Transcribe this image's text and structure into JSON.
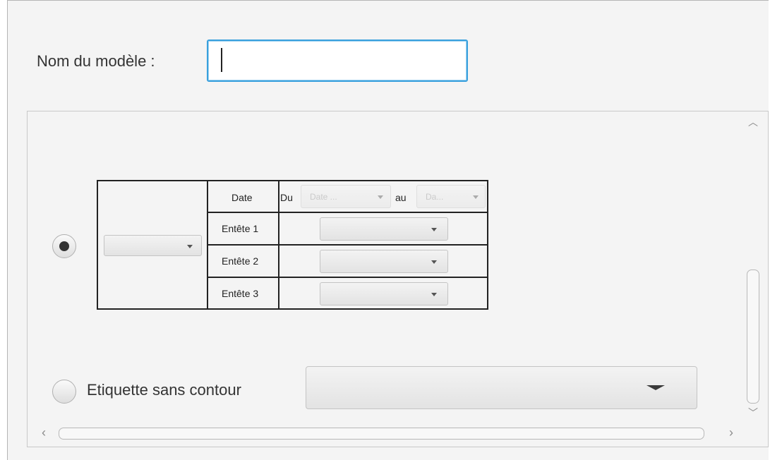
{
  "form": {
    "name_label": "Nom du modèle :",
    "name_value": "",
    "name_placeholder": ""
  },
  "option_table": {
    "selected": true,
    "combo_value": "",
    "date_row": {
      "header": "Date",
      "from_label": "Du",
      "from_placeholder": "Date ...",
      "to_label": "au",
      "to_placeholder": "Da..."
    },
    "rows": [
      {
        "header": "Entête 1",
        "value": ""
      },
      {
        "header": "Entête 2",
        "value": ""
      },
      {
        "header": "Entête 3",
        "value": ""
      }
    ]
  },
  "option_label": {
    "selected": false,
    "label": "Etiquette sans contour",
    "combo_value": ""
  }
}
